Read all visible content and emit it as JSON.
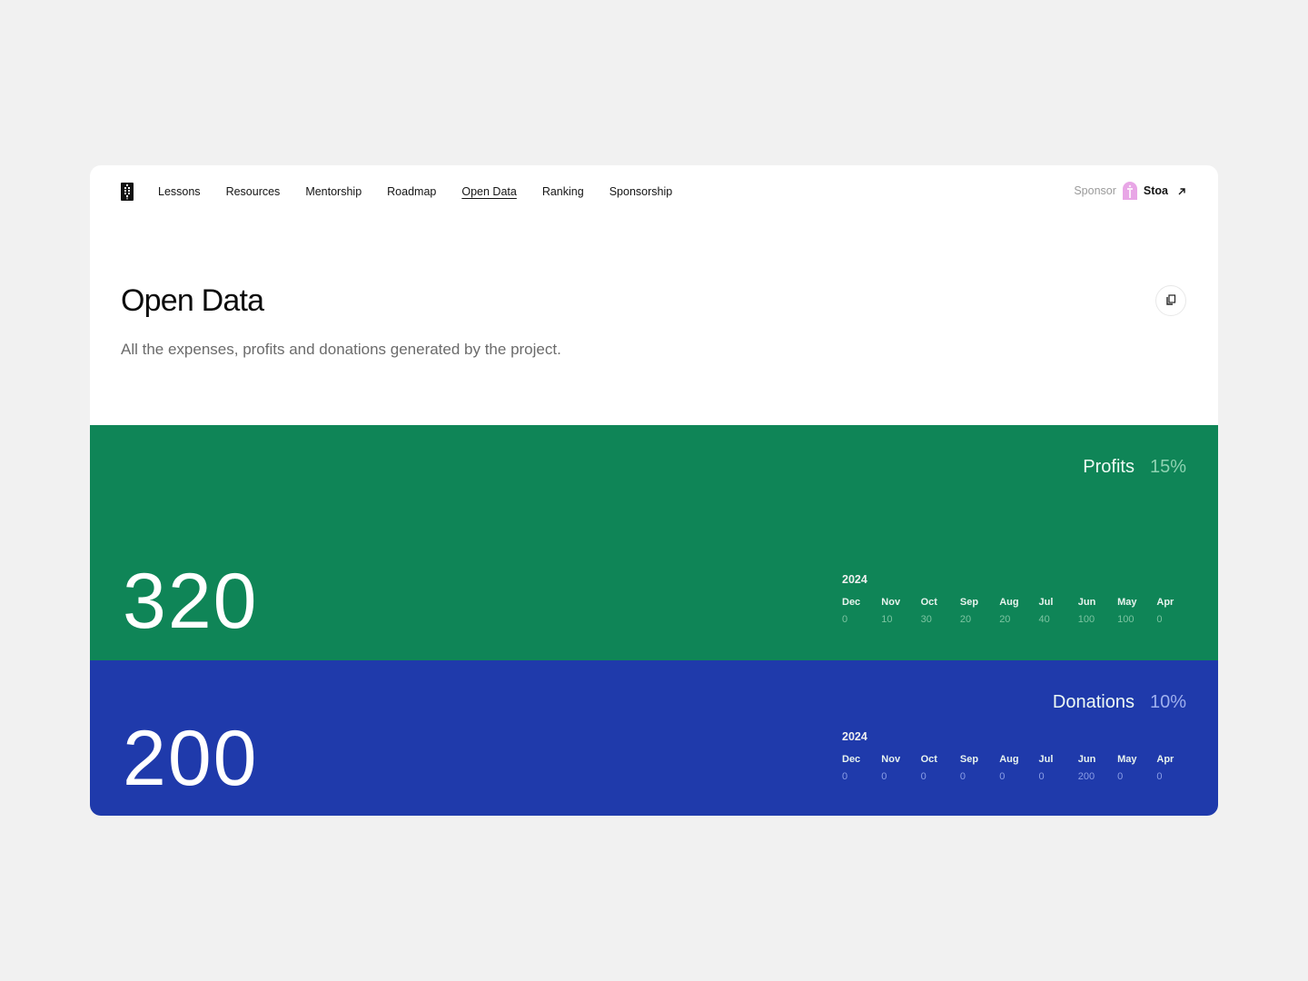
{
  "nav": {
    "logo": "app-logo",
    "links": [
      {
        "label": "Lessons",
        "active": false
      },
      {
        "label": "Resources",
        "active": false
      },
      {
        "label": "Mentorship",
        "active": false
      },
      {
        "label": "Roadmap",
        "active": false
      },
      {
        "label": "Open Data",
        "active": true
      },
      {
        "label": "Ranking",
        "active": false
      },
      {
        "label": "Sponsorship",
        "active": false
      }
    ],
    "sponsor": {
      "label": "Sponsor",
      "name": "Stoa",
      "icon": "external-link-arrow-icon"
    }
  },
  "header": {
    "title": "Open Data",
    "subtitle": "All the expenses, profits and donations generated by the project.",
    "copy_icon": "copy-icon"
  },
  "colors": {
    "profits": "#0f8557",
    "donations": "#1f3aab",
    "page_bg": "#f1f1f1"
  },
  "sections": {
    "profits": {
      "name": "Profits",
      "percent": "15%",
      "total": "320",
      "year": "2024",
      "months": [
        {
          "month": "Dec",
          "value": "0"
        },
        {
          "month": "Nov",
          "value": "10"
        },
        {
          "month": "Oct",
          "value": "30"
        },
        {
          "month": "Sep",
          "value": "20"
        },
        {
          "month": "Aug",
          "value": "20"
        },
        {
          "month": "Jul",
          "value": "40"
        },
        {
          "month": "Jun",
          "value": "100"
        },
        {
          "month": "May",
          "value": "100"
        },
        {
          "month": "Apr",
          "value": "0"
        }
      ]
    },
    "donations": {
      "name": "Donations",
      "percent": "10%",
      "total": "200",
      "year": "2024",
      "months": [
        {
          "month": "Dec",
          "value": "0"
        },
        {
          "month": "Nov",
          "value": "0"
        },
        {
          "month": "Oct",
          "value": "0"
        },
        {
          "month": "Sep",
          "value": "0"
        },
        {
          "month": "Aug",
          "value": "0"
        },
        {
          "month": "Jul",
          "value": "0"
        },
        {
          "month": "Jun",
          "value": "200"
        },
        {
          "month": "May",
          "value": "0"
        },
        {
          "month": "Apr",
          "value": "0"
        }
      ]
    }
  }
}
